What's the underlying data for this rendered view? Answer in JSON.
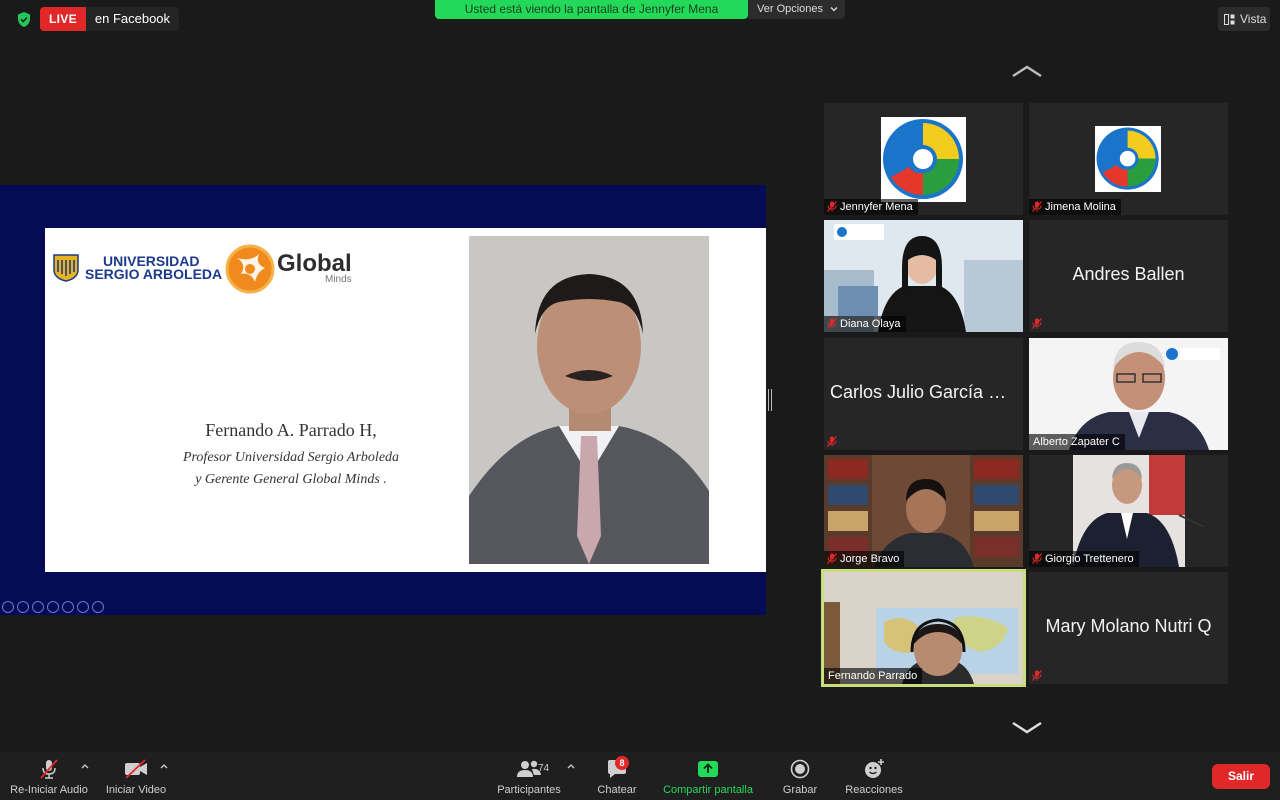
{
  "topbar": {
    "live_label": "LIVE",
    "live_platform": "en Facebook",
    "share_notice": "Usted está viendo la pantalla de Jennyfer Mena",
    "view_options": "Ver Opciones",
    "view_button": "Vista"
  },
  "slide": {
    "university_line1": "UNIVERSIDAD",
    "university_line2": "SERGIO ARBOLEDA",
    "global_word": "Global",
    "global_sub": "Minds",
    "speaker_name": "Fernando A. Parrado H,",
    "speaker_role_line1": "Profesor Universidad Sergio Arboleda",
    "speaker_role_line2": "y Gerente General Global Minds ."
  },
  "gallery": {
    "tiles": [
      {
        "name": "Jennyfer Mena",
        "type": "avatar-logo"
      },
      {
        "name": "Jimena Molina",
        "type": "avatar-logo"
      },
      {
        "name": "Diana Olaya",
        "type": "video",
        "overlay": "Cámara del Pacífico"
      },
      {
        "name": "Andres Ballen",
        "type": "name-only"
      },
      {
        "name": "Carlos Julio García Ro...",
        "type": "name-only"
      },
      {
        "name": "Alberto Zapater C",
        "type": "video",
        "overlay": "Cámara del Pacífico"
      },
      {
        "name": "Jorge Bravo",
        "type": "video"
      },
      {
        "name": "Giorgio Trettenero",
        "type": "video"
      },
      {
        "name": "Fernando Parrado",
        "type": "video",
        "active_speaker": true
      },
      {
        "name": "Mary Molano Nutri Q",
        "type": "name-only"
      }
    ]
  },
  "toolbar": {
    "audio_label": "Re-Iniciar Audio",
    "video_label": "Iniciar Video",
    "participants_label": "Participantes",
    "participants_count": "74",
    "chat_label": "Chatear",
    "chat_badge": "8",
    "share_label": "Compartir pantalla",
    "record_label": "Grabar",
    "reactions_label": "Reacciones",
    "leave_label": "Salir"
  },
  "colors": {
    "share_green": "#23d959",
    "live_red": "#e02828",
    "active_speaker_border": "#c9df7f",
    "slide_background": "#050c55"
  }
}
